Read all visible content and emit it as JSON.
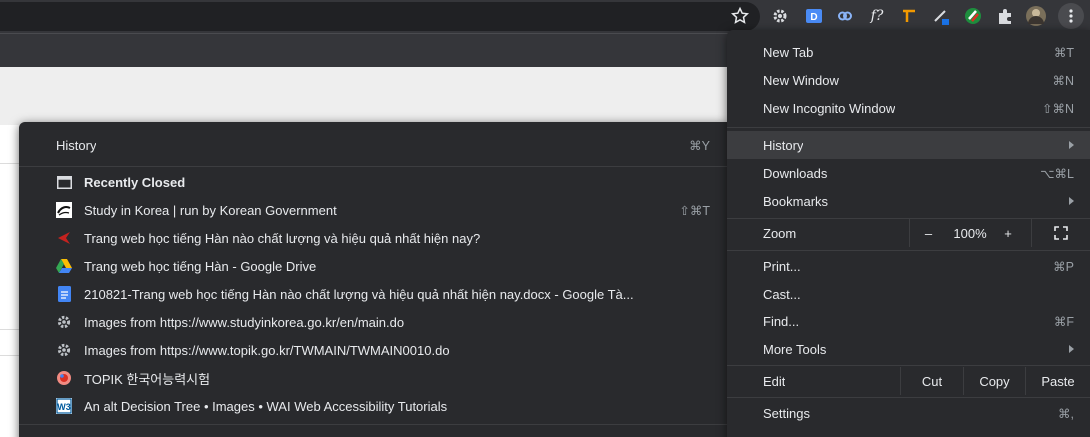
{
  "toolbar": {
    "extensions": [
      "gear-icon",
      "dictionary-extension-icon",
      "link-icon",
      "formula-extension-icon",
      "ruler-extension-icon",
      "color-picker-extension-icon",
      "grammar-extension-icon",
      "puzzle-extensions-icon",
      "profile-avatar",
      "more-menu-icon"
    ],
    "extension_f_label": "f?"
  },
  "history_menu": {
    "title": "History",
    "title_shortcut": "⌘Y",
    "recently_closed": "Recently Closed",
    "items": [
      {
        "icon": "studyinkorea-favicon",
        "label": "Study in Korea | run by Korean Government",
        "shortcut": "⇧⌘T"
      },
      {
        "icon": "red-arrow-favicon",
        "label": "Trang web học tiếng Hàn nào chất lượng và hiệu quả nhất hiện nay?",
        "shortcut": ""
      },
      {
        "icon": "google-drive-icon",
        "label": "Trang web học tiếng Hàn - Google Drive",
        "shortcut": ""
      },
      {
        "icon": "google-docs-icon",
        "label": "210821-Trang web học tiếng Hàn nào chất lượng và hiệu quả nhất hiện nay.docx - Google Tà...",
        "shortcut": ""
      },
      {
        "icon": "gear-icon",
        "label": "Images from https://www.studyinkorea.go.kr/en/main.do",
        "shortcut": ""
      },
      {
        "icon": "gear-icon",
        "label": "Images from https://www.topik.go.kr/TWMAIN/TWMAIN0010.do",
        "shortcut": ""
      },
      {
        "icon": "topik-favicon",
        "label": "TOPIK 한국어능력시험",
        "shortcut": ""
      },
      {
        "icon": "w3c-favicon",
        "label": "An alt Decision Tree • Images • WAI Web Accessibility Tutorials",
        "shortcut": ""
      }
    ]
  },
  "main_menu": {
    "new_tab": {
      "label": "New Tab",
      "shortcut": "⌘T"
    },
    "new_window": {
      "label": "New Window",
      "shortcut": "⌘N"
    },
    "new_incognito": {
      "label": "New Incognito Window",
      "shortcut": "⇧⌘N"
    },
    "history": {
      "label": "History"
    },
    "downloads": {
      "label": "Downloads",
      "shortcut": "⌥⌘L"
    },
    "bookmarks": {
      "label": "Bookmarks"
    },
    "zoom": {
      "label": "Zoom",
      "minus": "–",
      "value": "100%",
      "plus": "+"
    },
    "print": {
      "label": "Print...",
      "shortcut": "⌘P"
    },
    "cast": {
      "label": "Cast..."
    },
    "find": {
      "label": "Find...",
      "shortcut": "⌘F"
    },
    "more_tools": {
      "label": "More Tools"
    },
    "edit": {
      "label": "Edit",
      "cut": "Cut",
      "copy": "Copy",
      "paste": "Paste"
    },
    "settings": {
      "label": "Settings",
      "shortcut": "⌘,"
    }
  }
}
